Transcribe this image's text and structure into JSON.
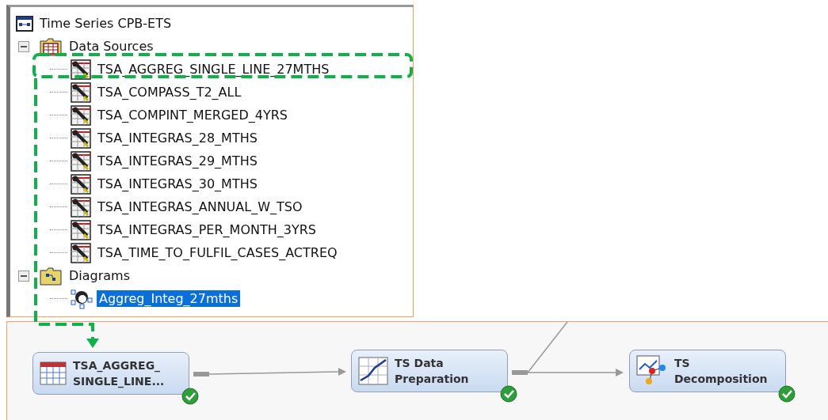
{
  "project_tree": {
    "label": "Time Series CPB-ETS",
    "children": [
      {
        "label": "Data Sources",
        "kind": "data_sources",
        "expanded": true,
        "children": [
          {
            "label": "TSA_AGGREG_SINGLE_LINE_27MTHS",
            "kind": "table",
            "selected": false
          },
          {
            "label": "TSA_COMPASS_T2_ALL",
            "kind": "table",
            "selected": false
          },
          {
            "label": "TSA_COMPINT_MERGED_4YRS",
            "kind": "table",
            "selected": false
          },
          {
            "label": "TSA_INTEGRAS_28_MTHS",
            "kind": "table",
            "selected": false
          },
          {
            "label": "TSA_INTEGRAS_29_MTHS",
            "kind": "table",
            "selected": false
          },
          {
            "label": "TSA_INTEGRAS_30_MTHS",
            "kind": "table",
            "selected": false
          },
          {
            "label": "TSA_INTEGRAS_ANNUAL_W_TSO",
            "kind": "table",
            "selected": false
          },
          {
            "label": "TSA_INTEGRAS_PER_MONTH_3YRS",
            "kind": "table",
            "selected": false
          },
          {
            "label": "TSA_TIME_TO_FULFIL_CASES_ACTREQ",
            "kind": "table",
            "selected": false
          }
        ]
      },
      {
        "label": "Diagrams",
        "kind": "diagrams",
        "expanded": true,
        "children": [
          {
            "label": "Aggreg_Integ_27mths",
            "kind": "diagram",
            "selected": true
          }
        ]
      }
    ]
  },
  "diagram": {
    "nodes": [
      {
        "kind": "data_source",
        "lines": [
          "TSA_AGGREG_",
          "SINGLE_LINE..."
        ],
        "completed": true
      },
      {
        "kind": "data_preparation",
        "lines": [
          "TS Data",
          "Preparation"
        ],
        "completed": true
      },
      {
        "kind": "decomposition",
        "lines": [
          "TS",
          "Decomposition"
        ],
        "completed": true
      }
    ]
  }
}
